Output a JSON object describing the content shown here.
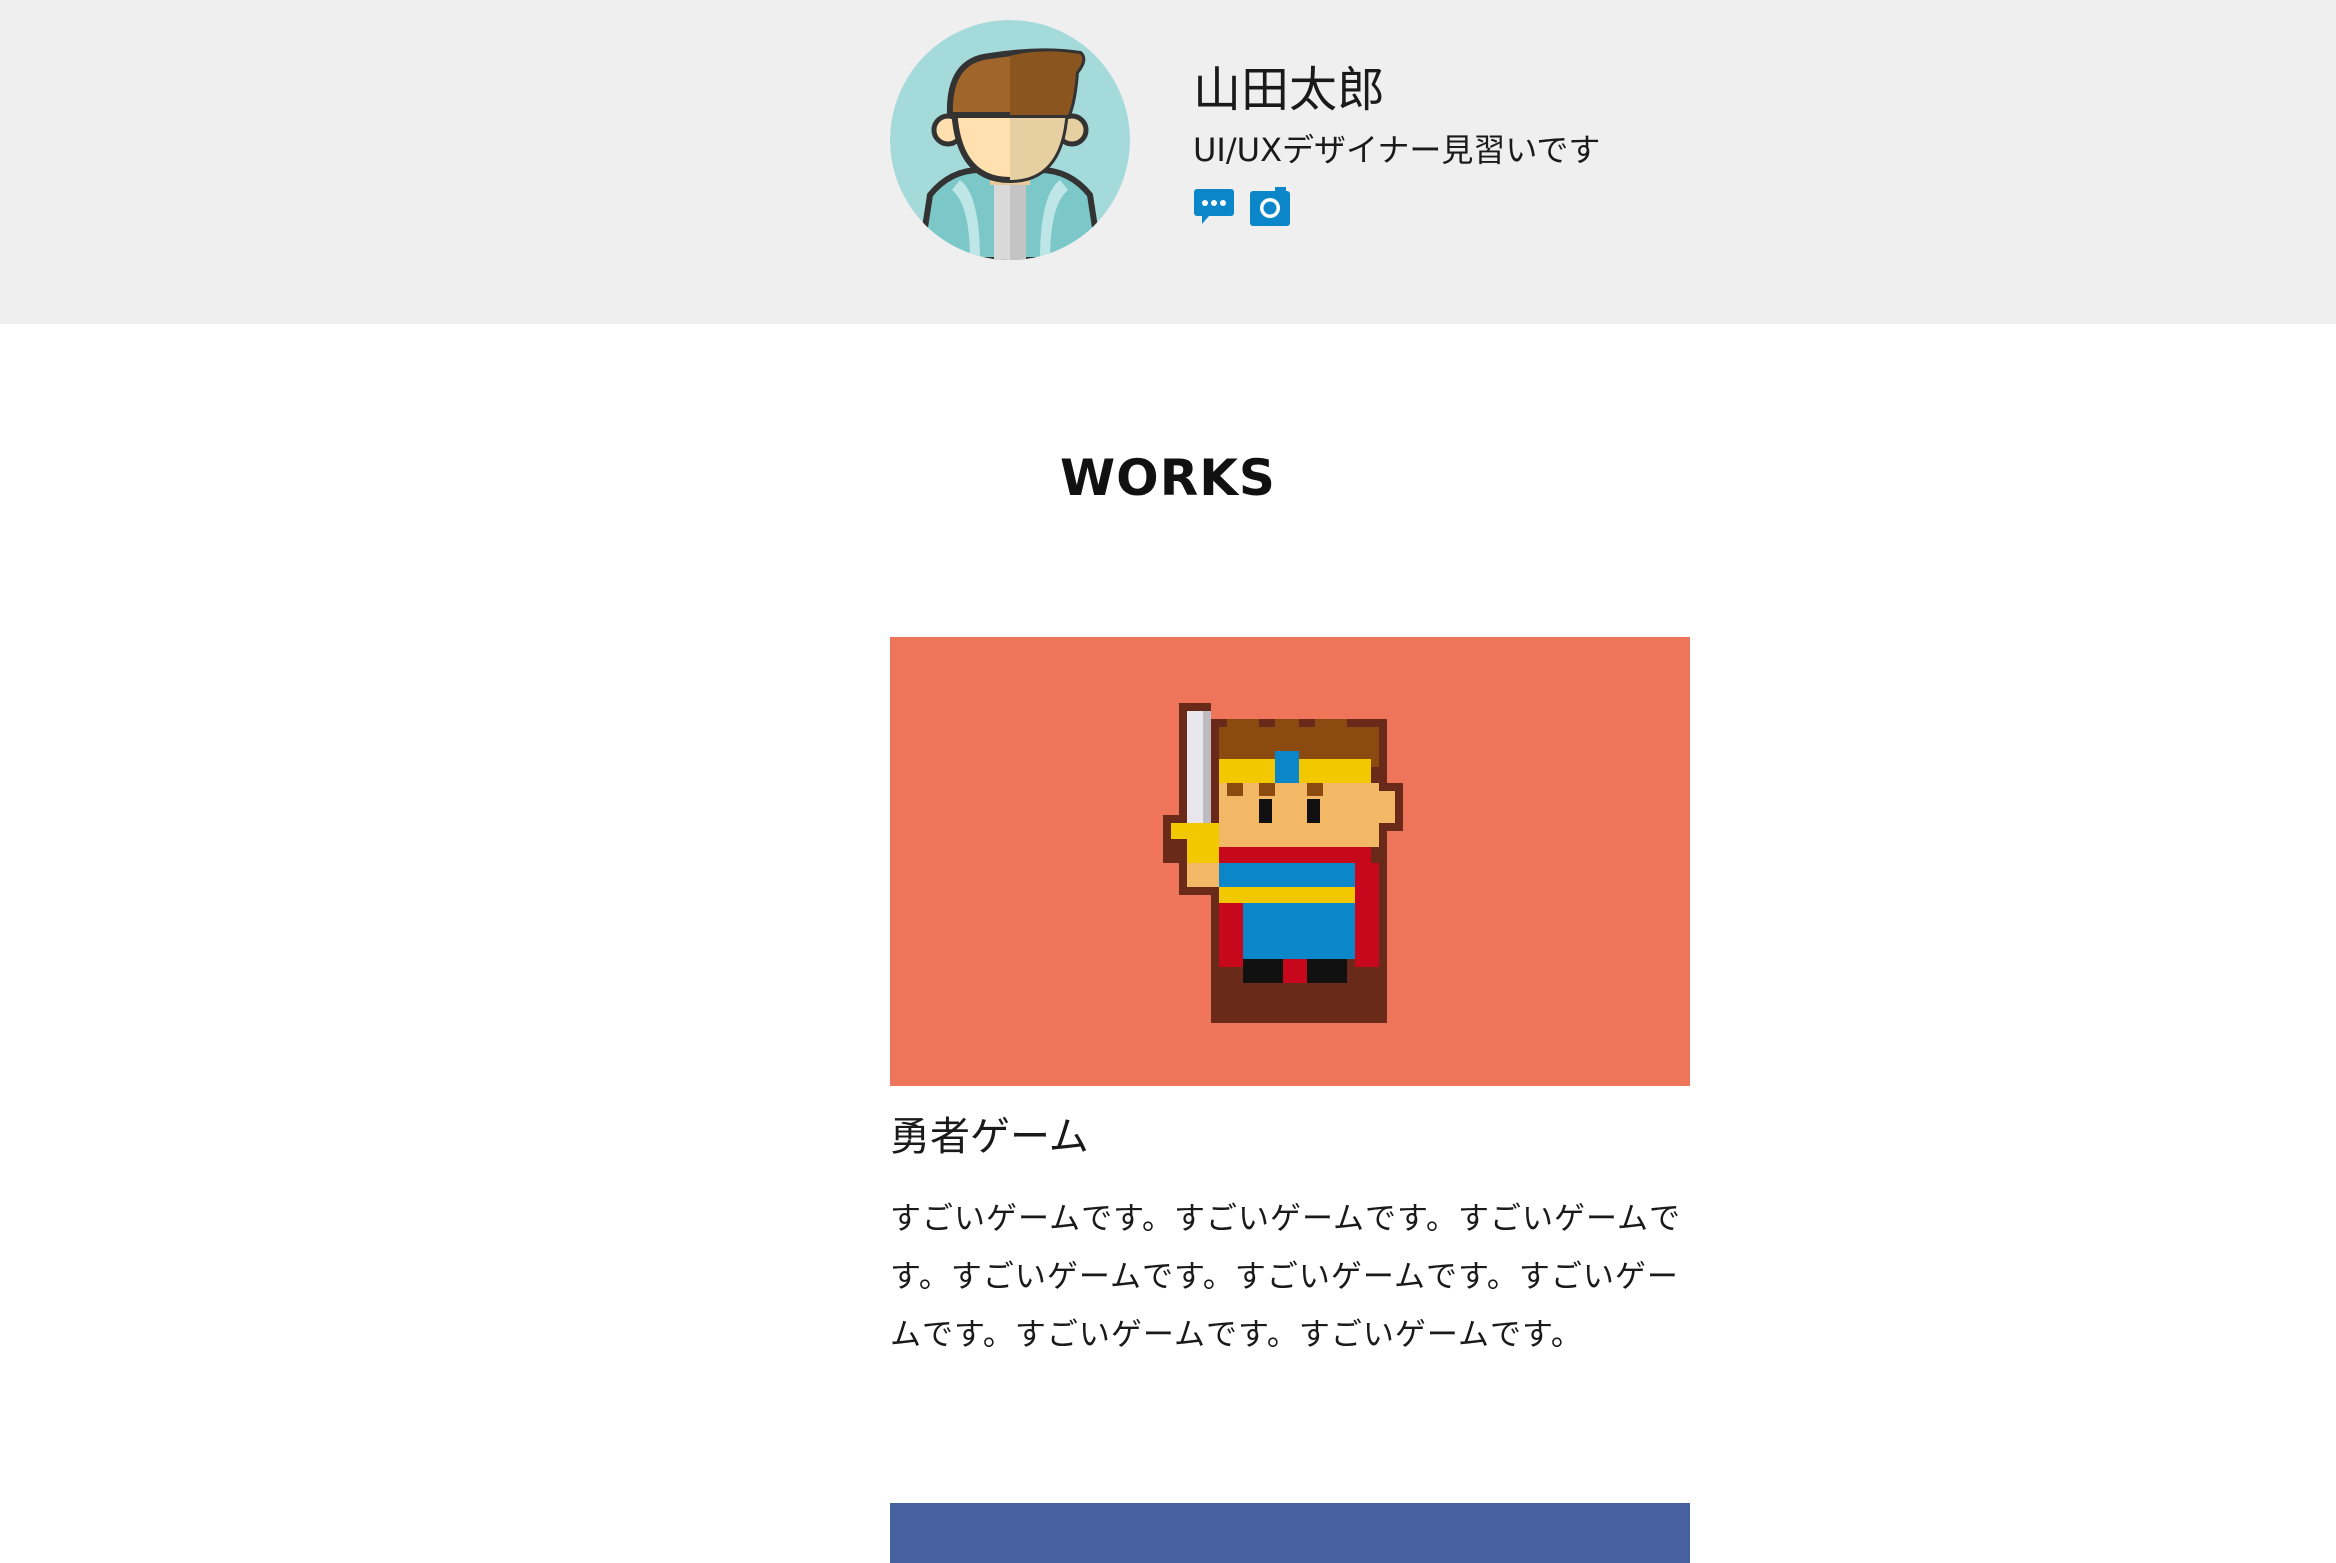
{
  "profile": {
    "name": "山田太郎",
    "title": "UI/UXデザイナー見習いです",
    "social": [
      {
        "icon": "chat-bubble-icon"
      },
      {
        "icon": "camera-icon"
      }
    ],
    "icon_color": "#0b87c9"
  },
  "works": {
    "heading": "WORKS",
    "items": [
      {
        "title": "勇者ゲーム",
        "description": "すごいゲームです。すごいゲームです。すごいゲームです。すごいゲームです。すごいゲームです。すごいゲームです。すごいゲームです。すごいゲームです。",
        "thumb_color": "#ee7559",
        "thumb_icon": "pixel-hero-icon"
      },
      {
        "title": "",
        "description": "",
        "thumb_color": "#4760a0"
      }
    ]
  },
  "colors": {
    "header_bg": "#efefef",
    "page_bg": "#ffffff"
  }
}
